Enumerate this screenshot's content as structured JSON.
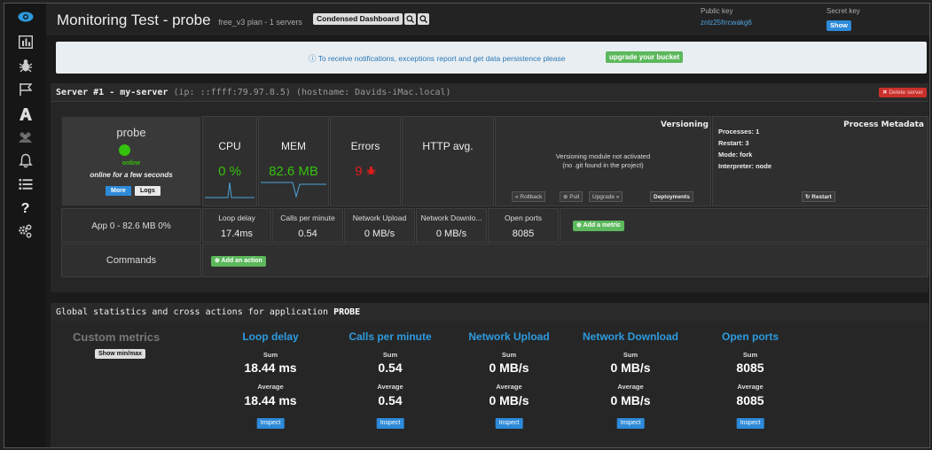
{
  "header": {
    "title": "Monitoring Test - probe",
    "plan": "free_v3 plan - 1 servers",
    "condensed_label": "Condensed Dashboard",
    "public_key_label": "Public key",
    "public_key_value": "znlz25frrcwakg6",
    "secret_key_label": "Secret key",
    "show_label": "Show"
  },
  "notice": {
    "text": "ⓘ To receive notifications, exceptions report and get data persistence please",
    "upgrade_label": "upgrade your bucket"
  },
  "server": {
    "title": "Server #1 - my-server",
    "meta": "(ip: ::ffff:79.97.8.5) (hostname: Davids-iMac.local)",
    "delete_label": "✖ Delete server",
    "process": {
      "name": "probe",
      "status": "online",
      "online_for": "online for a few seconds",
      "more_label": "More",
      "logs_label": "Logs"
    },
    "metrics": {
      "cpu_label": "CPU",
      "cpu_value": "0 %",
      "mem_label": "MEM",
      "mem_value": "82.6 MB",
      "errors_label": "Errors",
      "errors_value": "9",
      "http_label": "HTTP avg."
    },
    "versioning": {
      "title": "Versioning",
      "line1": "Versioning module not activated",
      "line2": "(no .git found in the project)",
      "rollback_label": "« Rollback",
      "pull_label": "⊕ Pull",
      "upgrade_label": "Upgrade »",
      "deployments_label": "Deployments"
    },
    "process_metadata": {
      "title": "Process Metadata",
      "processes": "Processes: 1",
      "restart": "Restart: 3",
      "mode": "Mode: fork",
      "interpreter": "Interpreter: node",
      "restart_button": "↻ Restart"
    },
    "app_row": {
      "label": "App 0 - 82.6 MB 0%",
      "items": [
        {
          "label": "Loop delay",
          "value": "17.4ms"
        },
        {
          "label": "Calls per minute",
          "value": "0.54"
        },
        {
          "label": "Network Upload",
          "value": "0 MB/s"
        },
        {
          "label": "Network Downlo...",
          "value": "0 MB/s"
        },
        {
          "label": "Open ports",
          "value": "8085"
        }
      ],
      "add_metric_label": "⊕ Add a metric"
    },
    "commands": {
      "label": "Commands",
      "add_action_label": "⊕ Add an action"
    }
  },
  "global": {
    "title_prefix": "Global statistics and cross actions for application",
    "app_name": "PROBE",
    "custom_metrics_label": "Custom metrics",
    "show_minmax_label": "Show min/max",
    "sum_label": "Sum",
    "average_label": "Average",
    "inspect_label": "Inspect",
    "columns": [
      {
        "title": "Loop delay",
        "sum": "18.44 ms",
        "average": "18.44 ms"
      },
      {
        "title": "Calls per minute",
        "sum": "0.54",
        "average": "0.54"
      },
      {
        "title": "Network Upload",
        "sum": "0 MB/s",
        "average": "0 MB/s"
      },
      {
        "title": "Network Download",
        "sum": "0 MB/s",
        "average": "0 MB/s"
      },
      {
        "title": "Open ports",
        "sum": "8085",
        "average": "8085"
      }
    ]
  },
  "colors": {
    "accent_blue": "#2d8ad8",
    "online_green": "#35c10d",
    "error_red": "#e01c1c",
    "button_green": "#5cb85c"
  },
  "sidebar_icons": [
    "eye-icon",
    "bar-chart-icon",
    "bug-icon",
    "flag-icon",
    "font-icon",
    "users-icon",
    "bell-icon",
    "list-icon",
    "question-icon",
    "cogs-icon"
  ]
}
